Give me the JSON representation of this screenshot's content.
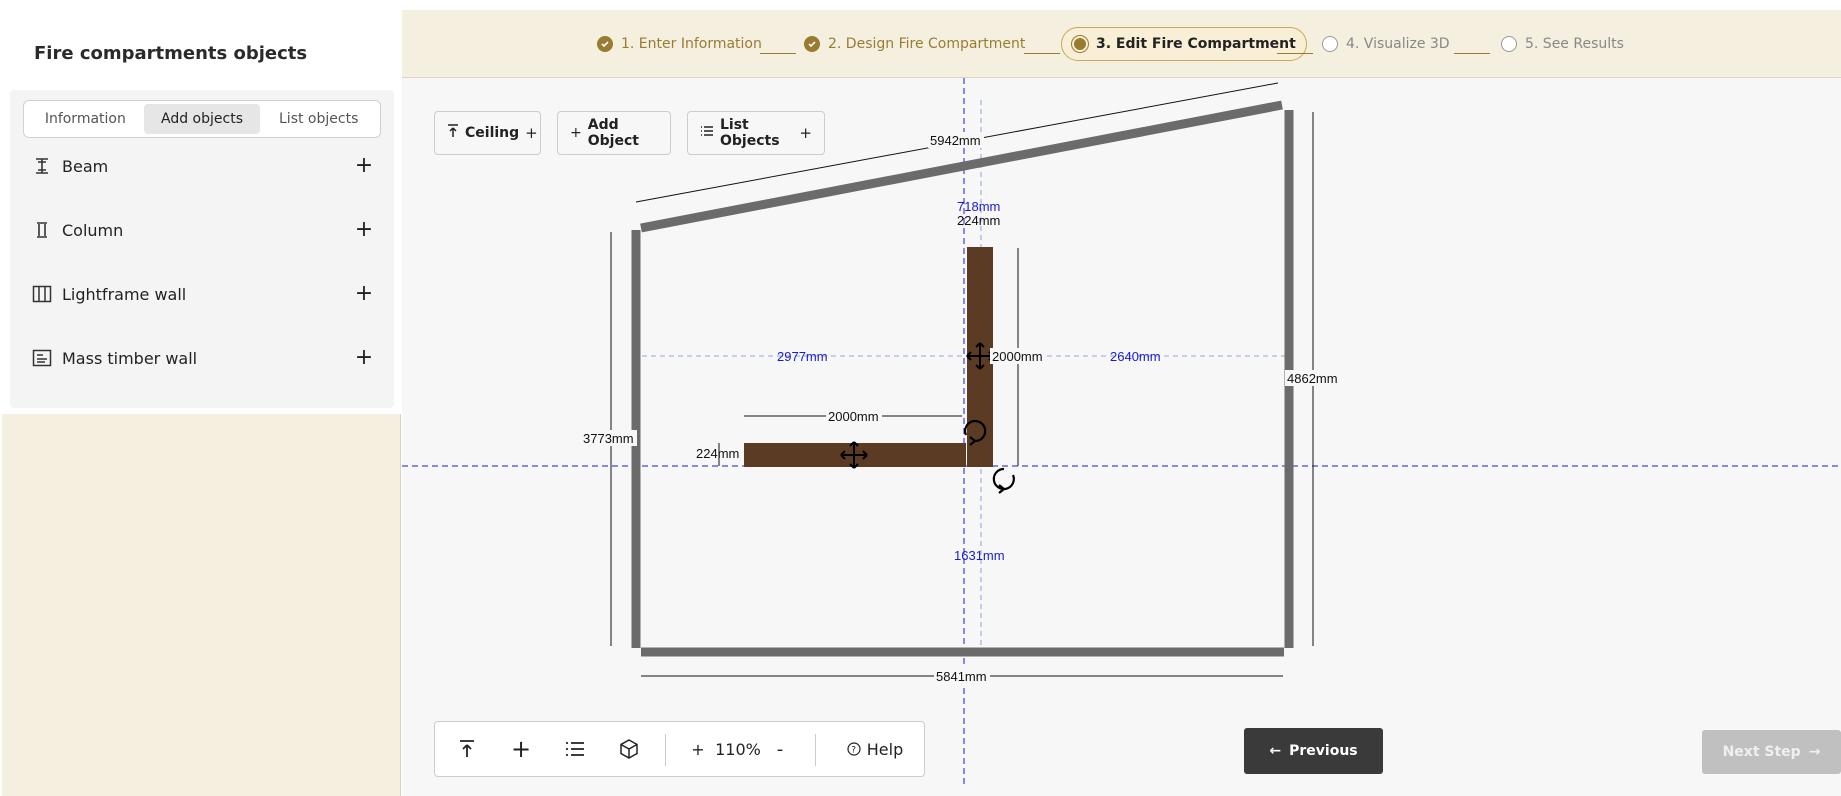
{
  "sidebar": {
    "title": "Fire compartments objects",
    "tabs": [
      "Information",
      "Add objects",
      "List objects"
    ],
    "active_tab": "Add objects",
    "items": [
      {
        "label": "Beam",
        "icon": "beam-icon"
      },
      {
        "label": "Column",
        "icon": "column-icon"
      },
      {
        "label": "Lightframe wall",
        "icon": "lightframe-wall-icon"
      },
      {
        "label": "Mass timber wall",
        "icon": "mass-timber-wall-icon"
      }
    ]
  },
  "stepper": {
    "steps": [
      {
        "label": "1. Enter Information",
        "state": "done"
      },
      {
        "label": "2. Design Fire Compartment",
        "state": "done"
      },
      {
        "label": "3. Edit Fire Compartment",
        "state": "current"
      },
      {
        "label": "4. Visualize 3D",
        "state": "todo"
      },
      {
        "label": "5. See Results",
        "state": "todo"
      }
    ]
  },
  "canvas_toolbar": {
    "ceiling": "Ceiling",
    "add_object": "Add Object",
    "list_objects": "List Objects"
  },
  "dimensions": {
    "top_wall": "5942mm",
    "bottom_wall": "5841mm",
    "left_wall": "3773mm",
    "right_wall": "4862mm",
    "vert_piece_length": "2000mm",
    "vert_piece_width": "224mm",
    "horiz_piece_length": "2000mm",
    "horiz_piece_width": "224mm",
    "gap_left": "2977mm",
    "gap_right": "2640mm",
    "gap_top": "718mm",
    "gap_bottom": "1631mm"
  },
  "bottom_toolbar": {
    "zoom_in": "+",
    "zoom_level": "110%",
    "zoom_out": "-",
    "help": "Help"
  },
  "nav": {
    "previous": "Previous",
    "next": "Next Step"
  },
  "colors": {
    "accent": "#9a7b32",
    "header_bg": "#f5efdf",
    "wall": "#6b6b6b",
    "timber": "#5c3b24",
    "guide_blue": "#1a1ad6"
  }
}
